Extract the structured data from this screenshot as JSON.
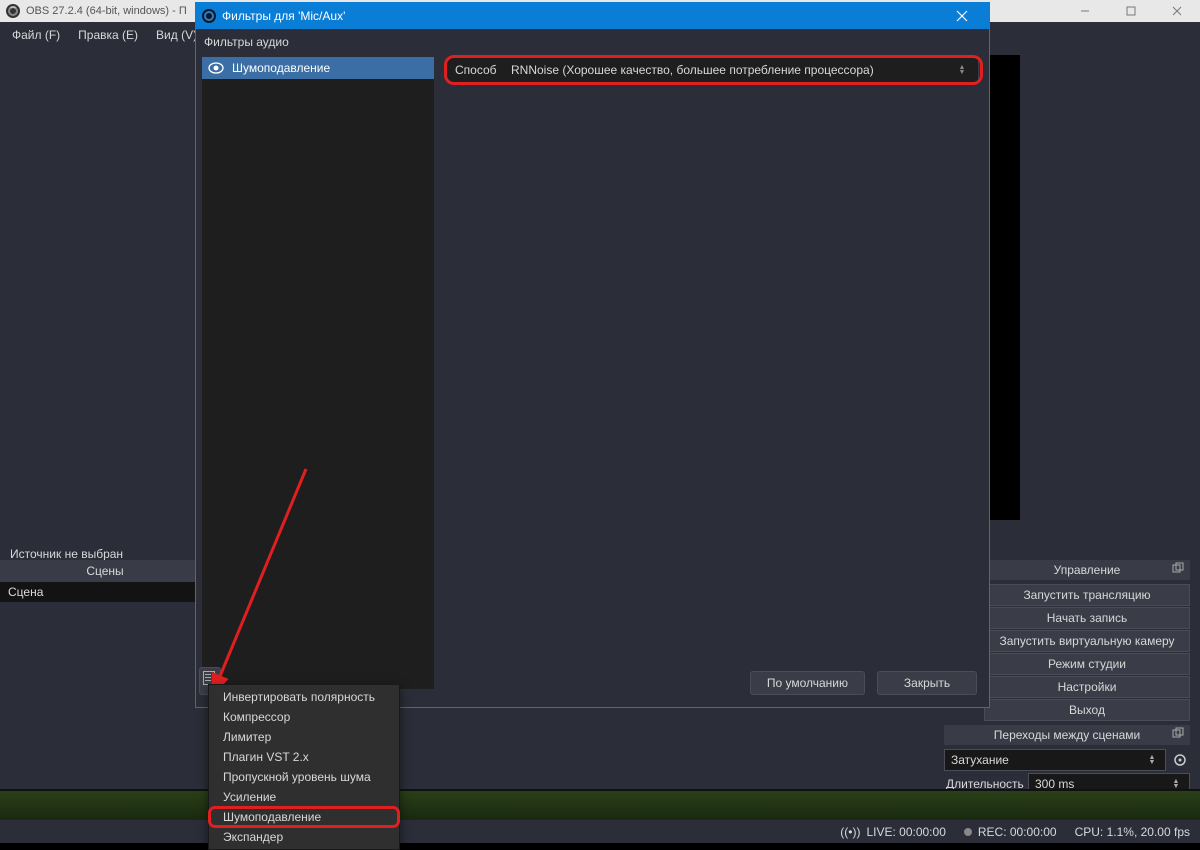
{
  "main_window": {
    "title": "OBS 27.2.4 (64-bit, windows) - П",
    "menu": {
      "file": "Файл (F)",
      "edit": "Правка (E)",
      "view": "Вид (V)"
    },
    "no_source": "Источник не выбран",
    "scenes_header": "Сцены",
    "scene_name": "Сцена"
  },
  "controls": {
    "header": "Управление",
    "start_stream": "Запустить трансляцию",
    "start_record": "Начать запись",
    "start_vcam": "Запустить виртуальную камеру",
    "studio_mode": "Режим студии",
    "settings": "Настройки",
    "exit": "Выход"
  },
  "transitions": {
    "header": "Переходы между сценами",
    "selected": "Затухание",
    "duration_label": "Длительность",
    "duration_value": "300 ms"
  },
  "statusbar": {
    "live": "LIVE: 00:00:00",
    "rec": "REC: 00:00:00",
    "cpu": "CPU: 1.1%, 20.00 fps"
  },
  "modal": {
    "title": "Фильтры для 'Mic/Aux'",
    "section_label": "Фильтры аудио",
    "filter_name": "Шумоподавление",
    "method_label": "Способ",
    "method_value": "RNNoise (Хорошее качество, большее потребление процессора)",
    "defaults_btn": "По умолчанию",
    "close_btn": "Закрыть"
  },
  "context_menu": {
    "items": [
      "Инвертировать полярность",
      "Компрессор",
      "Лимитер",
      "Плагин VST 2.x",
      "Пропускной уровень шума",
      "Усиление",
      "Шумоподавление",
      "Экспандер"
    ],
    "highlighted_index": 6
  }
}
